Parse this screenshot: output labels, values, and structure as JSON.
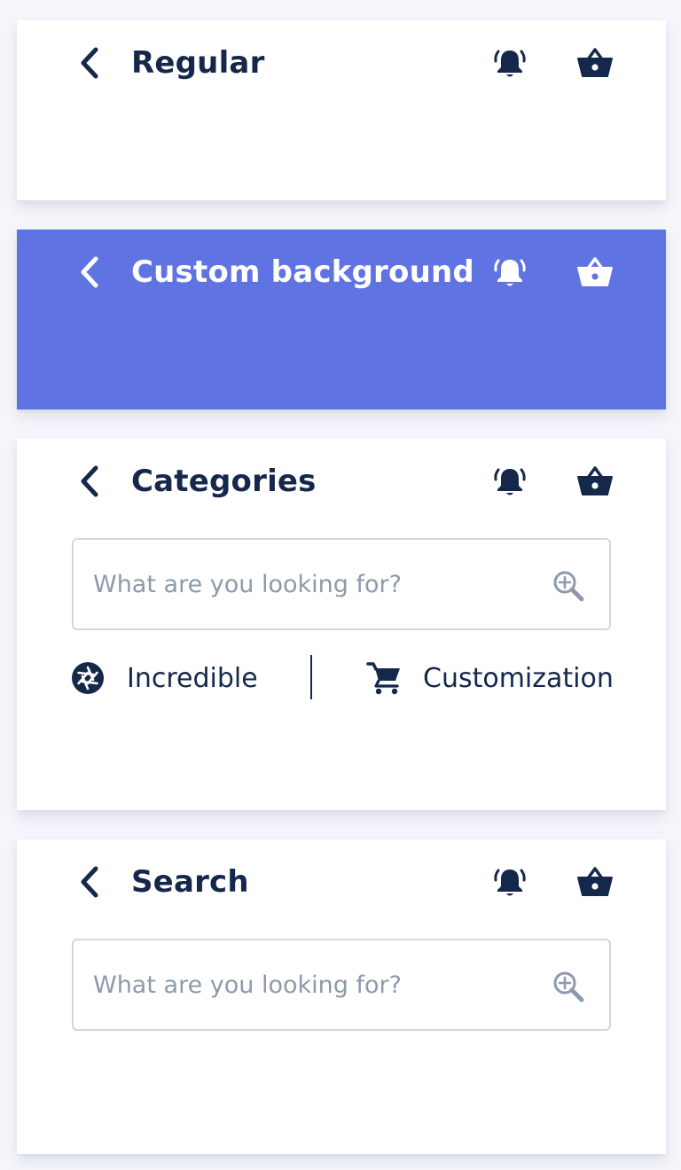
{
  "colors": {
    "navy": "#15284b",
    "accent": "#5f73e3",
    "card": "#ffffff",
    "page": "#f4f6fb",
    "placeholder": "#8c9aab"
  },
  "cards": [
    {
      "id": "regular",
      "title": "Regular",
      "icons": [
        "chevron-left-icon",
        "bell-icon",
        "basket-icon"
      ]
    },
    {
      "id": "custom",
      "title": "Custom background",
      "background": "#5f73e3",
      "icons": [
        "chevron-left-icon",
        "bell-icon",
        "basket-icon"
      ]
    },
    {
      "id": "categories",
      "title": "Categories",
      "icons": [
        "chevron-left-icon",
        "bell-icon",
        "basket-icon"
      ],
      "search": {
        "placeholder": "What are you looking for?",
        "value": "",
        "icon": "zoom-in-icon"
      },
      "items": [
        {
          "label": "Incredible",
          "icon": "aperture-icon"
        },
        {
          "label": "Customization",
          "icon": "cart-icon"
        }
      ]
    },
    {
      "id": "search",
      "title": "Search",
      "icons": [
        "chevron-left-icon",
        "bell-icon",
        "basket-icon"
      ],
      "search": {
        "placeholder": "What are you looking for?",
        "value": "",
        "icon": "zoom-in-icon"
      }
    }
  ]
}
